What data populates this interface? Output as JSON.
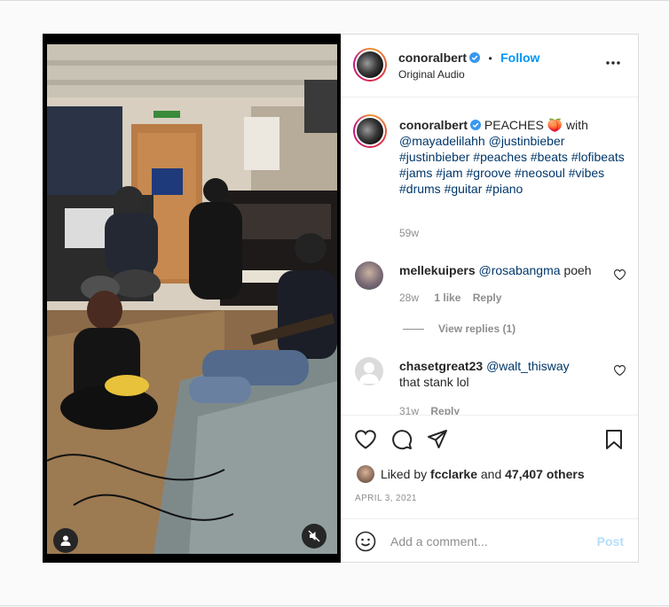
{
  "post": {
    "username": "conoralbert",
    "follow_label": "Follow",
    "separator": "•",
    "audio": "Original Audio",
    "caption": {
      "username": "conoralbert",
      "text_start": "PEACHES",
      "emoji": "🍑",
      "text_with": "with",
      "mentions": [
        "@mayadelilahh",
        "@justinbieber"
      ],
      "hashtags": [
        "#justinbieber",
        "#peaches",
        "#beats",
        "#lofibeats",
        "#jams",
        "#jam",
        "#groove",
        "#neosoul",
        "#vibes",
        "#drums",
        "#guitar",
        "#piano"
      ],
      "age": "59w"
    },
    "comments": [
      {
        "username": "mellekuipers",
        "mention": "@rosabangma",
        "text": "poeh",
        "age": "28w",
        "likes": "1 like",
        "reply_label": "Reply",
        "view_replies": "View replies (1)"
      },
      {
        "username": "chasetgreat23",
        "mention": "@walt_thisway",
        "text": "that stank lol",
        "age": "31w",
        "reply_label": "Reply"
      }
    ],
    "liked_by": {
      "prefix": "Liked by",
      "user": "fcclarke",
      "and": "and",
      "others": "47,407 others"
    },
    "date": "APRIL 3, 2021",
    "add_comment_placeholder": "Add a comment...",
    "post_button": "Post"
  },
  "colors": {
    "accent": "#0095f6",
    "link": "#00376b",
    "muted": "#8e8e8e",
    "border": "#dbdbdb"
  },
  "icons": [
    "verified-badge-icon",
    "more-options-icon",
    "heart-icon",
    "comment-icon",
    "share-icon",
    "bookmark-icon",
    "emoji-icon",
    "user-tag-icon",
    "muted-speaker-icon"
  ]
}
